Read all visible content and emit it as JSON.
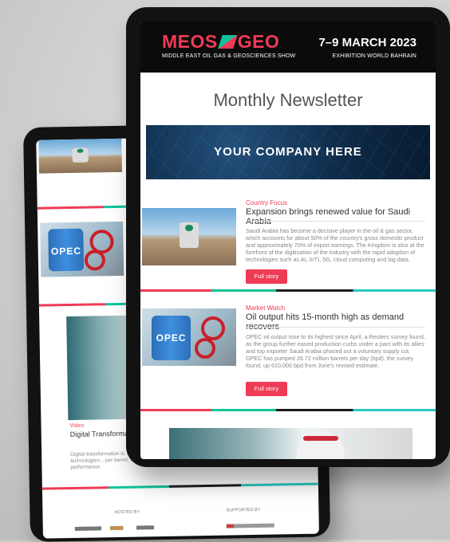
{
  "header": {
    "logo_left": "MEOS",
    "logo_right": "GEO",
    "logo_subtitle": "MIDDLE EAST OIL GAS & GEOSCIENCES SHOW",
    "date": "7–9 MARCH 2023",
    "venue": "EXHIBITION WORLD BAHRAIN"
  },
  "title": "Monthly Newsletter",
  "banner": "YOUR COMPANY HERE",
  "articles": [
    {
      "category": "Country Focus",
      "headline": "Expansion brings renewed value for Saudi Arabia",
      "body": "Saudi Arabia has become a decisive player in the oil & gas sector, which accounts for about 50% of the country's gross domestic product and approximately 70% of export earnings. The Kingdom is also at the forefront of the digitisation of the industry with the rapid adoption of technologies such as AI, IoT), 5G, cloud computing and big data.",
      "button": "Full story"
    },
    {
      "category": "Market Watch",
      "headline": "Oil output hits 15-month high as demand recovers",
      "body": "OPEC oil output rose to its highest since April, a Reuters survey found, as the group further eased production curbs under a pact with its allies and top exporter Saudi Arabia phased out a voluntary supply cut. OPEC has pumped 26.72 million barrels per day (bpd), the survey found, up 610,000 bpd from June's revised estimate.",
      "button": "Full story"
    }
  ],
  "back_tablet": {
    "video_category": "Video",
    "video_headline": "Digital Transformation",
    "video_body": "Digital transformation is ... Aramco's Chief Drilling Engi... most in-demand technologies... per barrel, reduce emissions, improve safety and optimise performance.",
    "barrel_label": "OPEC",
    "hosted_by": "HOSTED BY",
    "supported_by": "SUPPORTED BY"
  },
  "colors": {
    "accent": "#ef3b55",
    "green": "#10c39a",
    "dark": "#0b0b0b",
    "teal": "#2ac9c0"
  }
}
